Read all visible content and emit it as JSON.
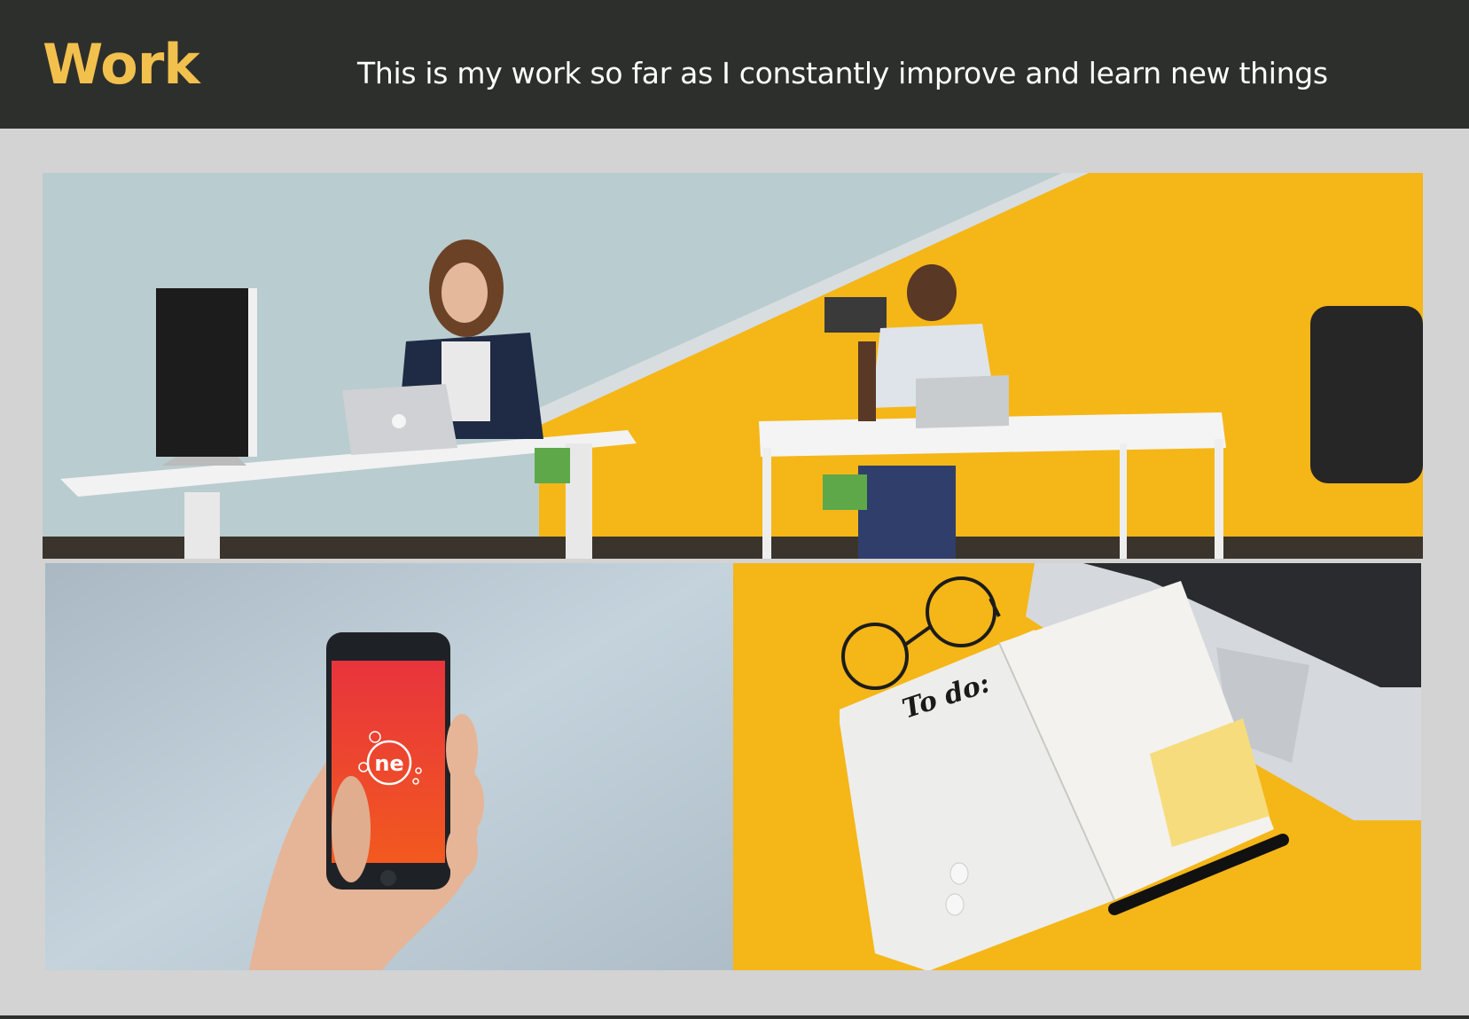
{
  "header": {
    "brand": "Work",
    "tagline": "This is my work so far as I constantly improve and learn new things"
  },
  "gallery": {
    "photos": [
      {
        "name": "office-photo"
      },
      {
        "name": "phone-photo",
        "app_logo_text": "ne"
      },
      {
        "name": "notebook-photo",
        "notebook_text": "To do:"
      }
    ]
  },
  "colors": {
    "header_bg": "#2d2f2c",
    "brand_yellow": "#f2c04d",
    "page_bg": "#d3d3d3",
    "accent_yellow": "#f5b617"
  }
}
